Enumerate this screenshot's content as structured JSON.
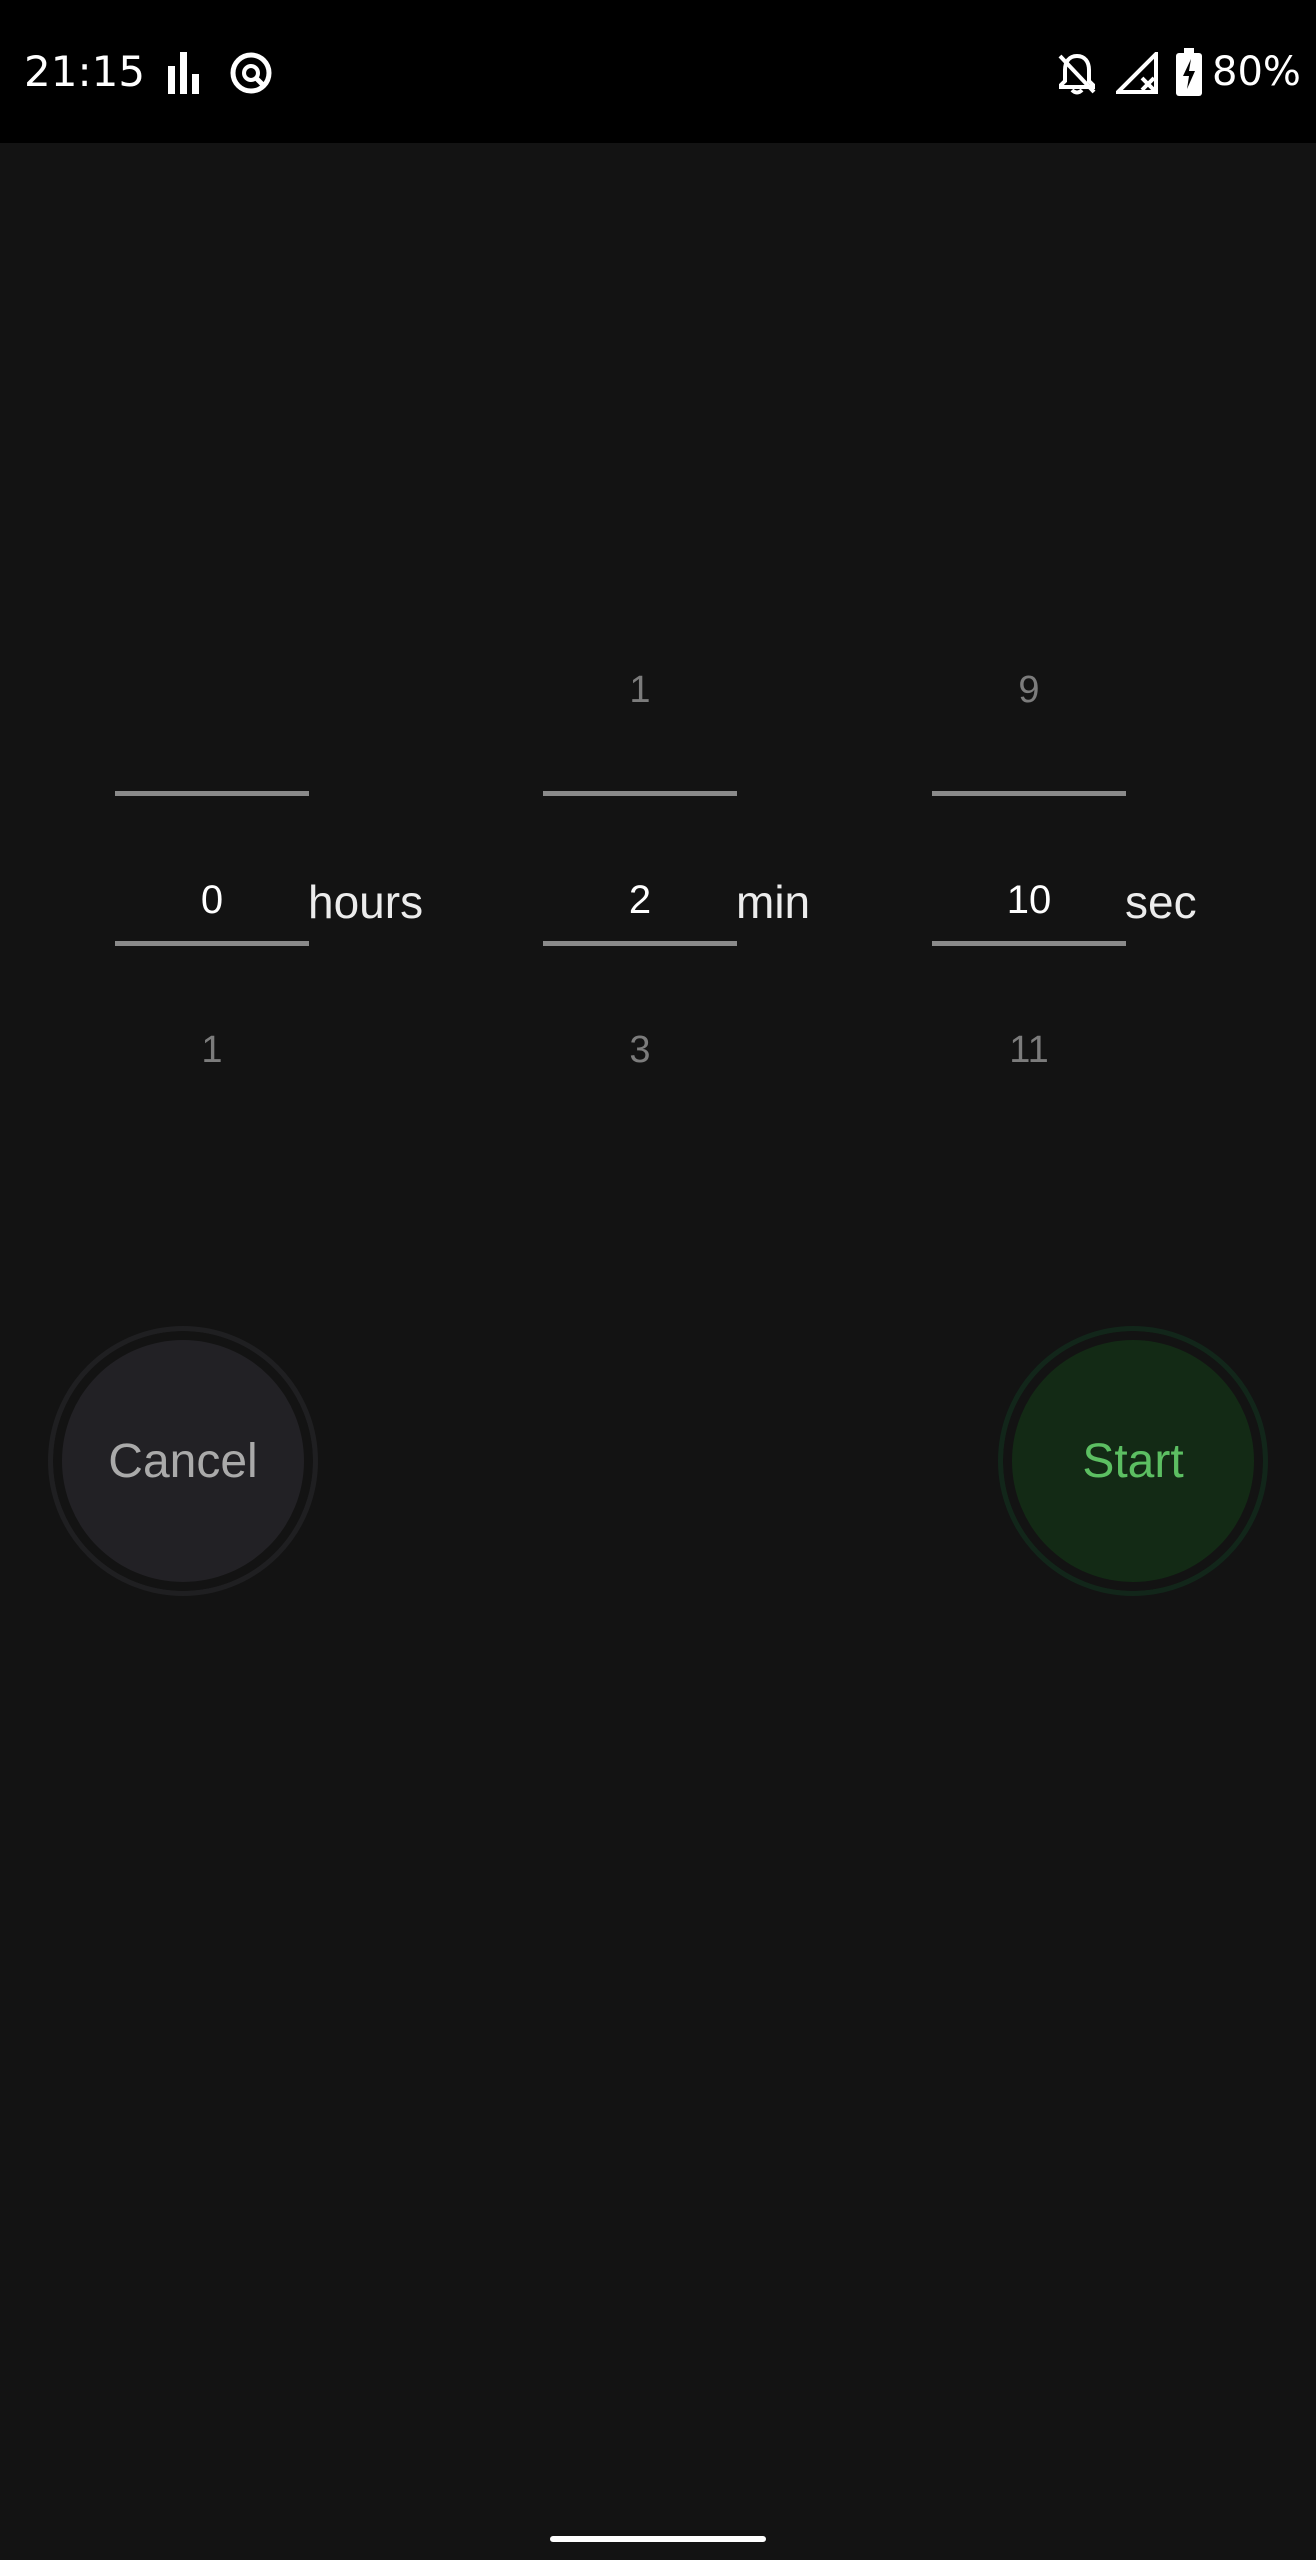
{
  "status_bar": {
    "time": "21:15",
    "battery_percent": "80%",
    "icons": [
      "signal-strength-icon",
      "data-saver-icon",
      "notifications-off-icon",
      "no-signal-icon",
      "battery-charging-icon"
    ]
  },
  "picker": {
    "hours": {
      "above": "",
      "selected": "0",
      "below": "1",
      "unit": "hours"
    },
    "minutes": {
      "above": "1",
      "selected": "2",
      "below": "3",
      "unit": "min"
    },
    "seconds": {
      "above": "9",
      "selected": "10",
      "below": "11",
      "unit": "sec"
    }
  },
  "buttons": {
    "cancel_label": "Cancel",
    "start_label": "Start"
  },
  "colors": {
    "background": "#131313",
    "start_accent": "#5cbf62",
    "start_fill": "#132a15",
    "cancel_fill": "#222125"
  }
}
